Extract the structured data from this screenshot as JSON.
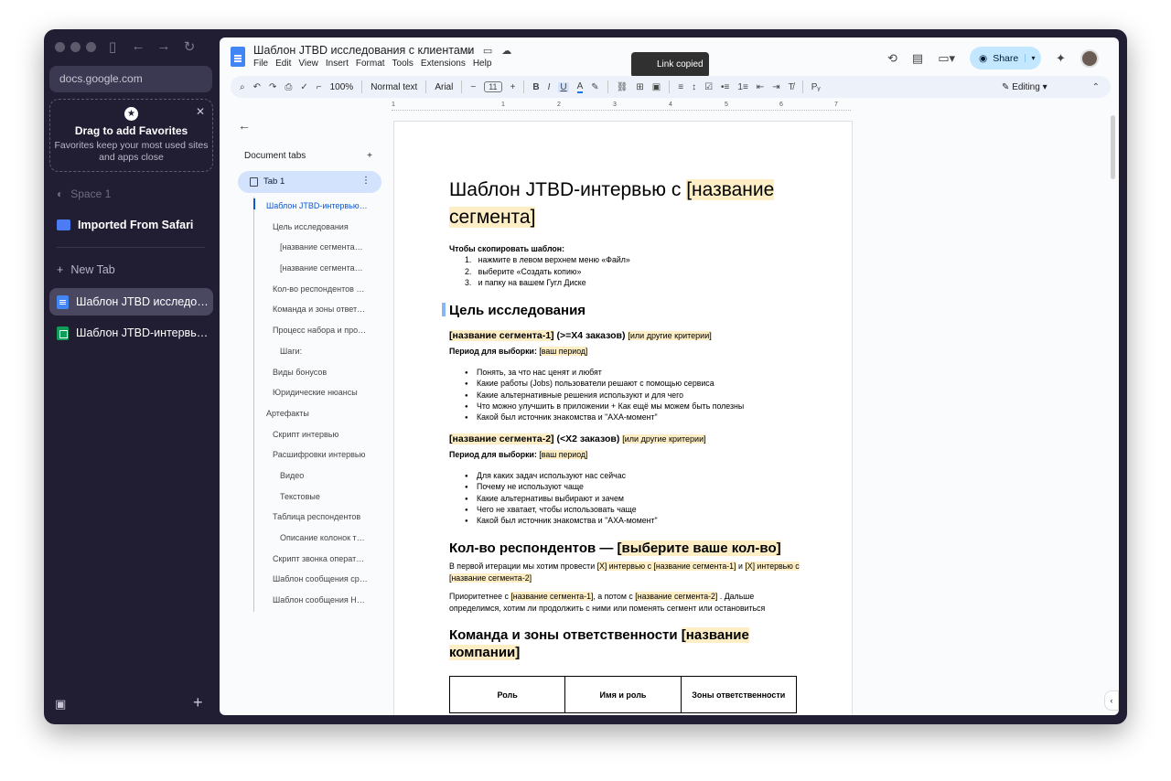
{
  "browser": {
    "url": "docs.google.com",
    "favorites": {
      "title": "Drag to add Favorites",
      "description": "Favorites keep your most used sites and apps close"
    },
    "space_label": "Space 1",
    "folder_label": "Imported From Safari",
    "new_tab_label": "New Tab",
    "tabs": [
      {
        "label": "Шаблон JTBD исследо…",
        "active": true,
        "icon": "docs-icon"
      },
      {
        "label": "Шаблон JTBD-интервь…",
        "active": false,
        "icon": "sheets-icon"
      }
    ]
  },
  "docs": {
    "title": "Шаблон JTBD исследования с клиентами",
    "menu": [
      "File",
      "Edit",
      "View",
      "Insert",
      "Format",
      "Tools",
      "Extensions",
      "Help"
    ],
    "toast": "Link copied",
    "share_label": "Share",
    "toolbar": {
      "zoom": "100%",
      "style": "Normal text",
      "font": "Arial",
      "font_size": "11",
      "mode": "Editing"
    },
    "ruler_marks": [
      "1",
      "1",
      "2",
      "3",
      "4",
      "5",
      "6",
      "7"
    ]
  },
  "outline": {
    "header": "Document tabs",
    "tab_label": "Tab 1",
    "items": [
      {
        "label": "Шаблон JTBD-интервью…",
        "level": 1,
        "current": true
      },
      {
        "label": "Цель исследования",
        "level": 2,
        "current": false
      },
      {
        "label": "[название сегмента…",
        "level": 3,
        "current": false
      },
      {
        "label": "[название сегмента…",
        "level": 3,
        "current": false
      },
      {
        "label": "Кол-во респондентов …",
        "level": 2,
        "current": false
      },
      {
        "label": "Команда и зоны ответ…",
        "level": 2,
        "current": false
      },
      {
        "label": "Процесс набора и про…",
        "level": 2,
        "current": false
      },
      {
        "label": "Шаги:",
        "level": 3,
        "current": false
      },
      {
        "label": "Виды бонусов",
        "level": 2,
        "current": false
      },
      {
        "label": "Юридические нюансы",
        "level": 2,
        "current": false
      },
      {
        "label": "Артефакты",
        "level": 1,
        "current": false
      },
      {
        "label": "Скрипт интервью",
        "level": 2,
        "current": false
      },
      {
        "label": "Расшифровки интервью",
        "level": 2,
        "current": false
      },
      {
        "label": "Видео",
        "level": 3,
        "current": false
      },
      {
        "label": "Текстовые",
        "level": 3,
        "current": false
      },
      {
        "label": "Таблица респондентов",
        "level": 2,
        "current": false
      },
      {
        "label": "Описание колонок т…",
        "level": 3,
        "current": false
      },
      {
        "label": "Скрипт звонка операт…",
        "level": 2,
        "current": false
      },
      {
        "label": "Шаблон сообщения ср…",
        "level": 2,
        "current": false
      },
      {
        "label": "Шаблон сообщения Н…",
        "level": 2,
        "current": false
      }
    ]
  },
  "page": {
    "title_plain": "Шаблон JTBD-интервью с ",
    "title_highlight": "[название сегмента]",
    "copy_heading": "Чтобы скопировать шаблон:",
    "copy_steps": [
      "нажмите в левом верхнем меню «Файл»",
      "выберите «Создать копию»",
      "и папку на вашем Гугл Диске"
    ],
    "goal_heading": "Цель исследования",
    "seg1": {
      "name": "[название сегмента-1]",
      "cond": " (>=X4 заказов) ",
      "crit": "[или другие критерии]",
      "period_label": "Период для выборки: ",
      "period_value": "[ваш период]",
      "bullets": [
        "Понять, за что нас ценят и любят",
        "Какие работы (Jobs) пользователи решают с помощью сервиса",
        "Какие альтернативные решения используют и для чего",
        "Что можно улучшить в приложении + Как ещё мы можем быть полезны",
        "Какой был источник знакомства и \"АХА-момент\""
      ]
    },
    "seg2": {
      "name": "[название сегмента-2]",
      "cond": " (<X2 заказов) ",
      "crit": "[или другие критерии]",
      "period_label": "Период для выборки:  ",
      "period_value": "[ваш период]",
      "bullets": [
        "Для каких задач используют нас сейчас",
        "Почему не используют чаще",
        "Какие альтернативы выбирают и зачем",
        "Чего не хватает, чтобы использовать чаще",
        "Какой был источник знакомства и \"АХА-момент\""
      ]
    },
    "count_heading_plain": "Кол-во респондентов — ",
    "count_heading_hl": "[выберите ваше кол-во]",
    "count_p1_a": "В первой итерации мы хотим провести ",
    "count_p1_b": "[X] интервью с [название сегмента-1]",
    "count_p1_c": " и ",
    "count_p1_d": "[X] интервью с [название сегмента-2]",
    "count_p2_a": "Приоритетнее с ",
    "count_p2_b": "[название сегмента-1]",
    "count_p2_c": ", а потом с ",
    "count_p2_d": "[название сегмента-2]",
    "count_p2_e": " . Дальше определимся, хотим ли продолжить с ними или поменять сегмент или остановиться",
    "team_heading_plain": "Команда и зоны ответственности ",
    "team_heading_hl": "[название компании]",
    "table_headers": [
      "Роль",
      "Имя и роль",
      "Зоны ответственности"
    ]
  }
}
